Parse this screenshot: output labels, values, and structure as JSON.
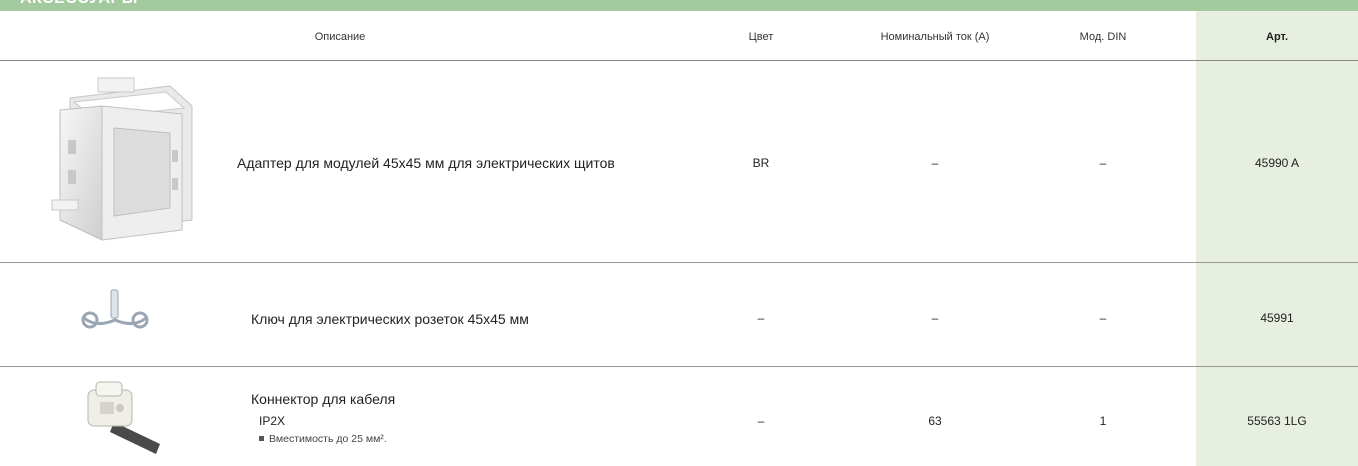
{
  "section": {
    "title": "АКСЕССУАРЫ"
  },
  "header": {
    "description": "Описание",
    "color": "Цвет",
    "current": "Номинальный ток (А)",
    "din": "Мод. DIN",
    "article": "Арт."
  },
  "rows": [
    {
      "image_icon": "frame-adapter-icon",
      "description": "Адаптер для модулей 45х45 мм для электрических щитов",
      "color": "BR",
      "current": "–",
      "din": "–",
      "article": "45990 A"
    },
    {
      "image_icon": "socket-key-icon",
      "description": "Ключ для электрических розеток 45х45 мм",
      "color": "–",
      "current": "–",
      "din": "–",
      "article": "45991"
    },
    {
      "image_icon": "cable-connector-icon",
      "description": "Коннектор для кабеля",
      "sub_line": "IP2X",
      "bullet": "Вместимость до 25 мм².",
      "color": "–",
      "current": "63",
      "din": "1",
      "article": "55563 1LG"
    }
  ],
  "colors": {
    "banner": "#a3c99e",
    "article_column": "#e7efe1",
    "divider": "#888888"
  }
}
